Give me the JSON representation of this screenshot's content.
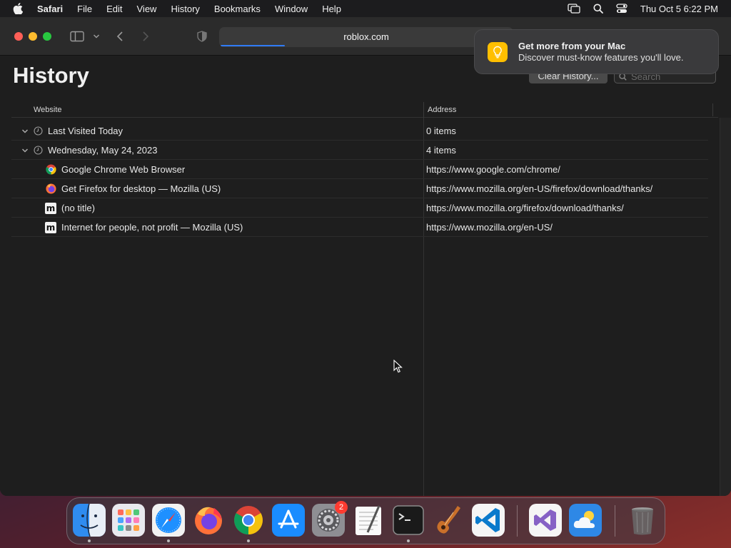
{
  "menubar": {
    "app_name": "Safari",
    "items": [
      "File",
      "Edit",
      "View",
      "History",
      "Bookmarks",
      "Window",
      "Help"
    ],
    "clock": "Thu Oct 5  6:22 PM"
  },
  "toolbar": {
    "url": "roblox.com",
    "loading_progress": 0.22
  },
  "page": {
    "title": "History",
    "clear_button": "Clear History...",
    "search_placeholder": "Search"
  },
  "table": {
    "headers": {
      "website": "Website",
      "address": "Address"
    },
    "groups": [
      {
        "label": "Last Visited Today",
        "count": "0 items"
      },
      {
        "label": "Wednesday, May 24, 2023",
        "count": "4 items"
      }
    ],
    "entries": [
      {
        "title": "Google Chrome Web Browser",
        "url": "https://www.google.com/chrome/",
        "icon": "chrome-icon"
      },
      {
        "title": "Get Firefox for desktop — Mozilla (US)",
        "url": "https://www.mozilla.org/en-US/firefox/download/thanks/",
        "icon": "firefox-icon"
      },
      {
        "title": "(no title)",
        "url": "https://www.mozilla.org/firefox/download/thanks/",
        "icon": "mozilla-icon"
      },
      {
        "title": "Internet for people, not profit — Mozilla (US)",
        "url": "https://www.mozilla.org/en-US/",
        "icon": "mozilla-icon"
      }
    ],
    "mozilla_glyph": "m"
  },
  "notification": {
    "title": "Get more from your Mac",
    "body": "Discover must-know features you'll love."
  },
  "dock": {
    "settings_badge": "2",
    "apps": [
      "finder-icon",
      "launchpad-icon",
      "safari-icon",
      "firefox-icon",
      "chrome-icon",
      "app-store-icon",
      "system-settings-icon",
      "textedit-icon",
      "terminal-icon",
      "garageband-icon",
      "vscode-icon",
      "visual-studio-icon",
      "weather-icon",
      "trash-icon"
    ]
  }
}
